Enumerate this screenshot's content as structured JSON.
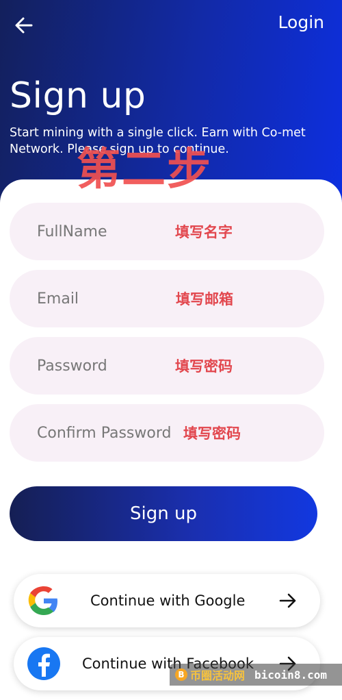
{
  "header": {
    "back_icon": "arrow-left-icon",
    "login_label": "Login",
    "title": "Sign up",
    "subtitle": "Start mining with a single click. Earn with Co-met Network. Please sign up to continue."
  },
  "overlay": {
    "step_text": "第二步"
  },
  "form": {
    "fields": [
      {
        "placeholder": "FullName",
        "hint": "填写名字"
      },
      {
        "placeholder": "Email",
        "hint": "填写邮箱"
      },
      {
        "placeholder": "Password",
        "hint": "填写密码"
      },
      {
        "placeholder": "Confirm Password",
        "hint": "填写密码"
      }
    ],
    "submit_label": "Sign up"
  },
  "social": [
    {
      "label": "Continue with Google",
      "icon": "google-icon"
    },
    {
      "label": "Continue with Facebook",
      "icon": "facebook-icon"
    }
  ],
  "watermark": {
    "text": "币圈活动网",
    "site": "bicoin8.com"
  },
  "colors": {
    "hero_start": "#13205c",
    "hero_end": "#0d2fe0",
    "field_bg": "#f8f0f7",
    "hint_red": "#e2474e"
  }
}
